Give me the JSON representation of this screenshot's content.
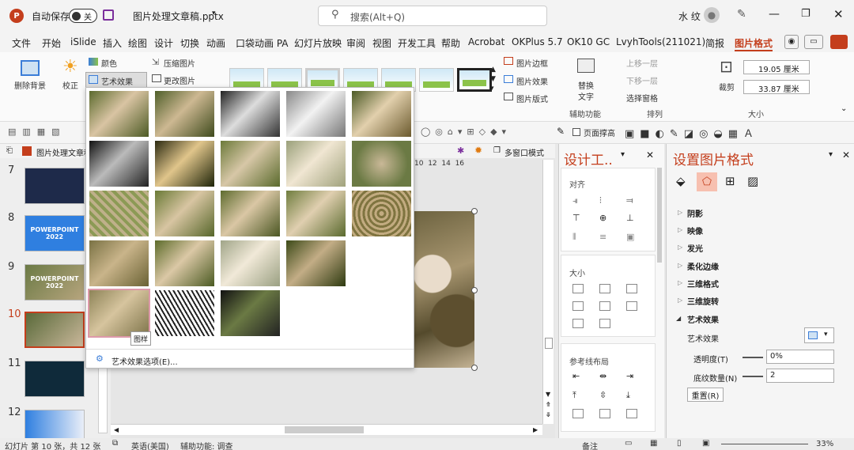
{
  "titlebar": {
    "autosave_label": "自动保存",
    "autosave_state": "关",
    "filename": "图片处理文章稿.pptx",
    "search_placeholder": "搜索(Alt+Q)",
    "user": "水 纹"
  },
  "menu": {
    "items": [
      "文件",
      "开始",
      "iSlide",
      "插入",
      "绘图",
      "设计",
      "切换",
      "动画",
      "口袋动画 PA",
      "幻灯片放映",
      "审阅",
      "视图",
      "开发工具",
      "帮助",
      "Acrobat",
      "OKPlus 5.7",
      "OK10 GC",
      "LvyhTools(211021)",
      "简报",
      "图片格式"
    ]
  },
  "ribbon": {
    "remove_bg": "删除背景",
    "correct": "校正",
    "color": "颜色",
    "art_effects": "艺术效果",
    "compress": "压缩图片",
    "change_pic": "更改图片",
    "pic_border": "图片边框",
    "pic_effects": "图片效果",
    "pic_layout": "图片版式",
    "alt_text_1": "替换",
    "alt_text_2": "文字",
    "accessibility": "辅助功能",
    "bring_forward": "上移一层",
    "send_backward": "下移一层",
    "selection_pane": "选择窗格",
    "arrange": "排列",
    "crop": "裁剪",
    "height": "19.05 厘米",
    "width": "33.87 厘米",
    "size": "大小"
  },
  "qat": {
    "fit_page": "页面撑高"
  },
  "tabs": {
    "doc_tab": "图片处理文章稿",
    "multi_window": "多窗口模式",
    "ruler": [
      "10",
      "12",
      "14",
      "16"
    ]
  },
  "slides": [
    {
      "num": "7"
    },
    {
      "num": "8",
      "text": "POWERPOINT 2022"
    },
    {
      "num": "9",
      "text": "POWERPOINT 2022"
    },
    {
      "num": "10"
    },
    {
      "num": "11"
    },
    {
      "num": "12"
    }
  ],
  "dropdown": {
    "tooltip": "图样",
    "options_label": "艺术效果选项(E)..."
  },
  "pane1": {
    "title": "设计工..",
    "align": "对齐",
    "size": "大小",
    "guides": "参考线布局"
  },
  "pane2": {
    "title": "设置图片格式",
    "items": [
      "阴影",
      "映像",
      "发光",
      "柔化边缘",
      "三维格式",
      "三维旋转",
      "艺术效果"
    ],
    "art_effect_label": "艺术效果",
    "transparency_label": "透明度(T)",
    "transparency_value": "0%",
    "texture_label": "底纹数量(N)",
    "texture_value": "2",
    "reset": "重置(R)"
  },
  "status": {
    "slide_info": "幻灯片 第 10 张，共 12 张",
    "lang": "英语(美国)",
    "access": "辅助功能: 调查",
    "notes": "备注",
    "zoom": "33%"
  }
}
